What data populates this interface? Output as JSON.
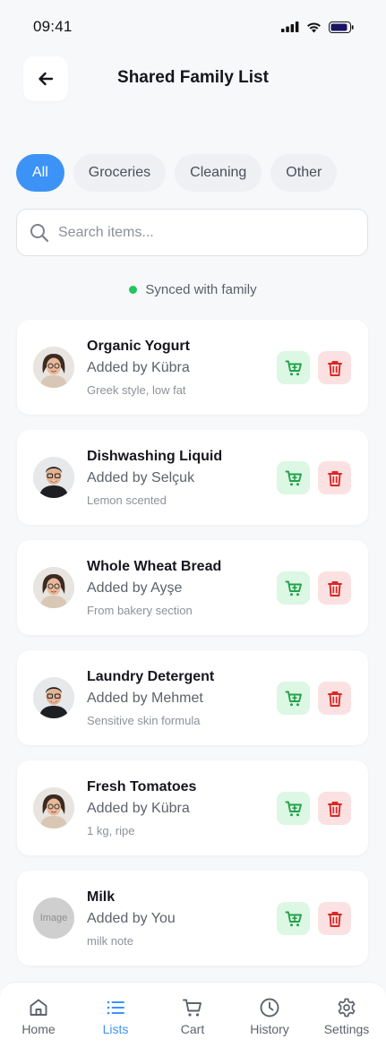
{
  "status_bar": {
    "time": "09:41"
  },
  "header": {
    "title": "Shared Family List"
  },
  "filters": [
    {
      "label": "All",
      "active": true
    },
    {
      "label": "Groceries",
      "active": false
    },
    {
      "label": "Cleaning",
      "active": false
    },
    {
      "label": "Other",
      "active": false
    }
  ],
  "search": {
    "placeholder": "Search items...",
    "value": ""
  },
  "sync": {
    "text": "Synced with family"
  },
  "items": [
    {
      "name": "Organic Yogurt",
      "added_by": "Added by Kübra",
      "note": "Greek style, low fat"
    },
    {
      "name": "Dishwashing Liquid",
      "added_by": "Added by Selçuk",
      "note": "Lemon scented"
    },
    {
      "name": "Whole Wheat Bread",
      "added_by": "Added by Ayşe",
      "note": "From bakery section"
    },
    {
      "name": "Laundry Detergent",
      "added_by": "Added by Mehmet",
      "note": "Sensitive skin formula"
    },
    {
      "name": "Fresh Tomatoes",
      "added_by": "Added by Kübra",
      "note": "1 kg, ripe"
    },
    {
      "name": "Milk",
      "added_by": "Added by You",
      "note": "milk note",
      "avatar_text": "Image"
    }
  ],
  "bottom_nav": [
    {
      "label": "Home",
      "icon": "home-icon"
    },
    {
      "label": "Lists",
      "icon": "list-icon",
      "active": true
    },
    {
      "label": "Cart",
      "icon": "cart-icon"
    },
    {
      "label": "History",
      "icon": "clock-icon"
    },
    {
      "label": "Settings",
      "icon": "gear-icon"
    }
  ],
  "colors": {
    "accent": "#3d93f5",
    "sync_green": "#22c55e",
    "cart_bg": "#dcf7e4",
    "cart_icon": "#22a24a",
    "delete_bg": "#fbe1e1",
    "delete_icon": "#dc2626"
  }
}
